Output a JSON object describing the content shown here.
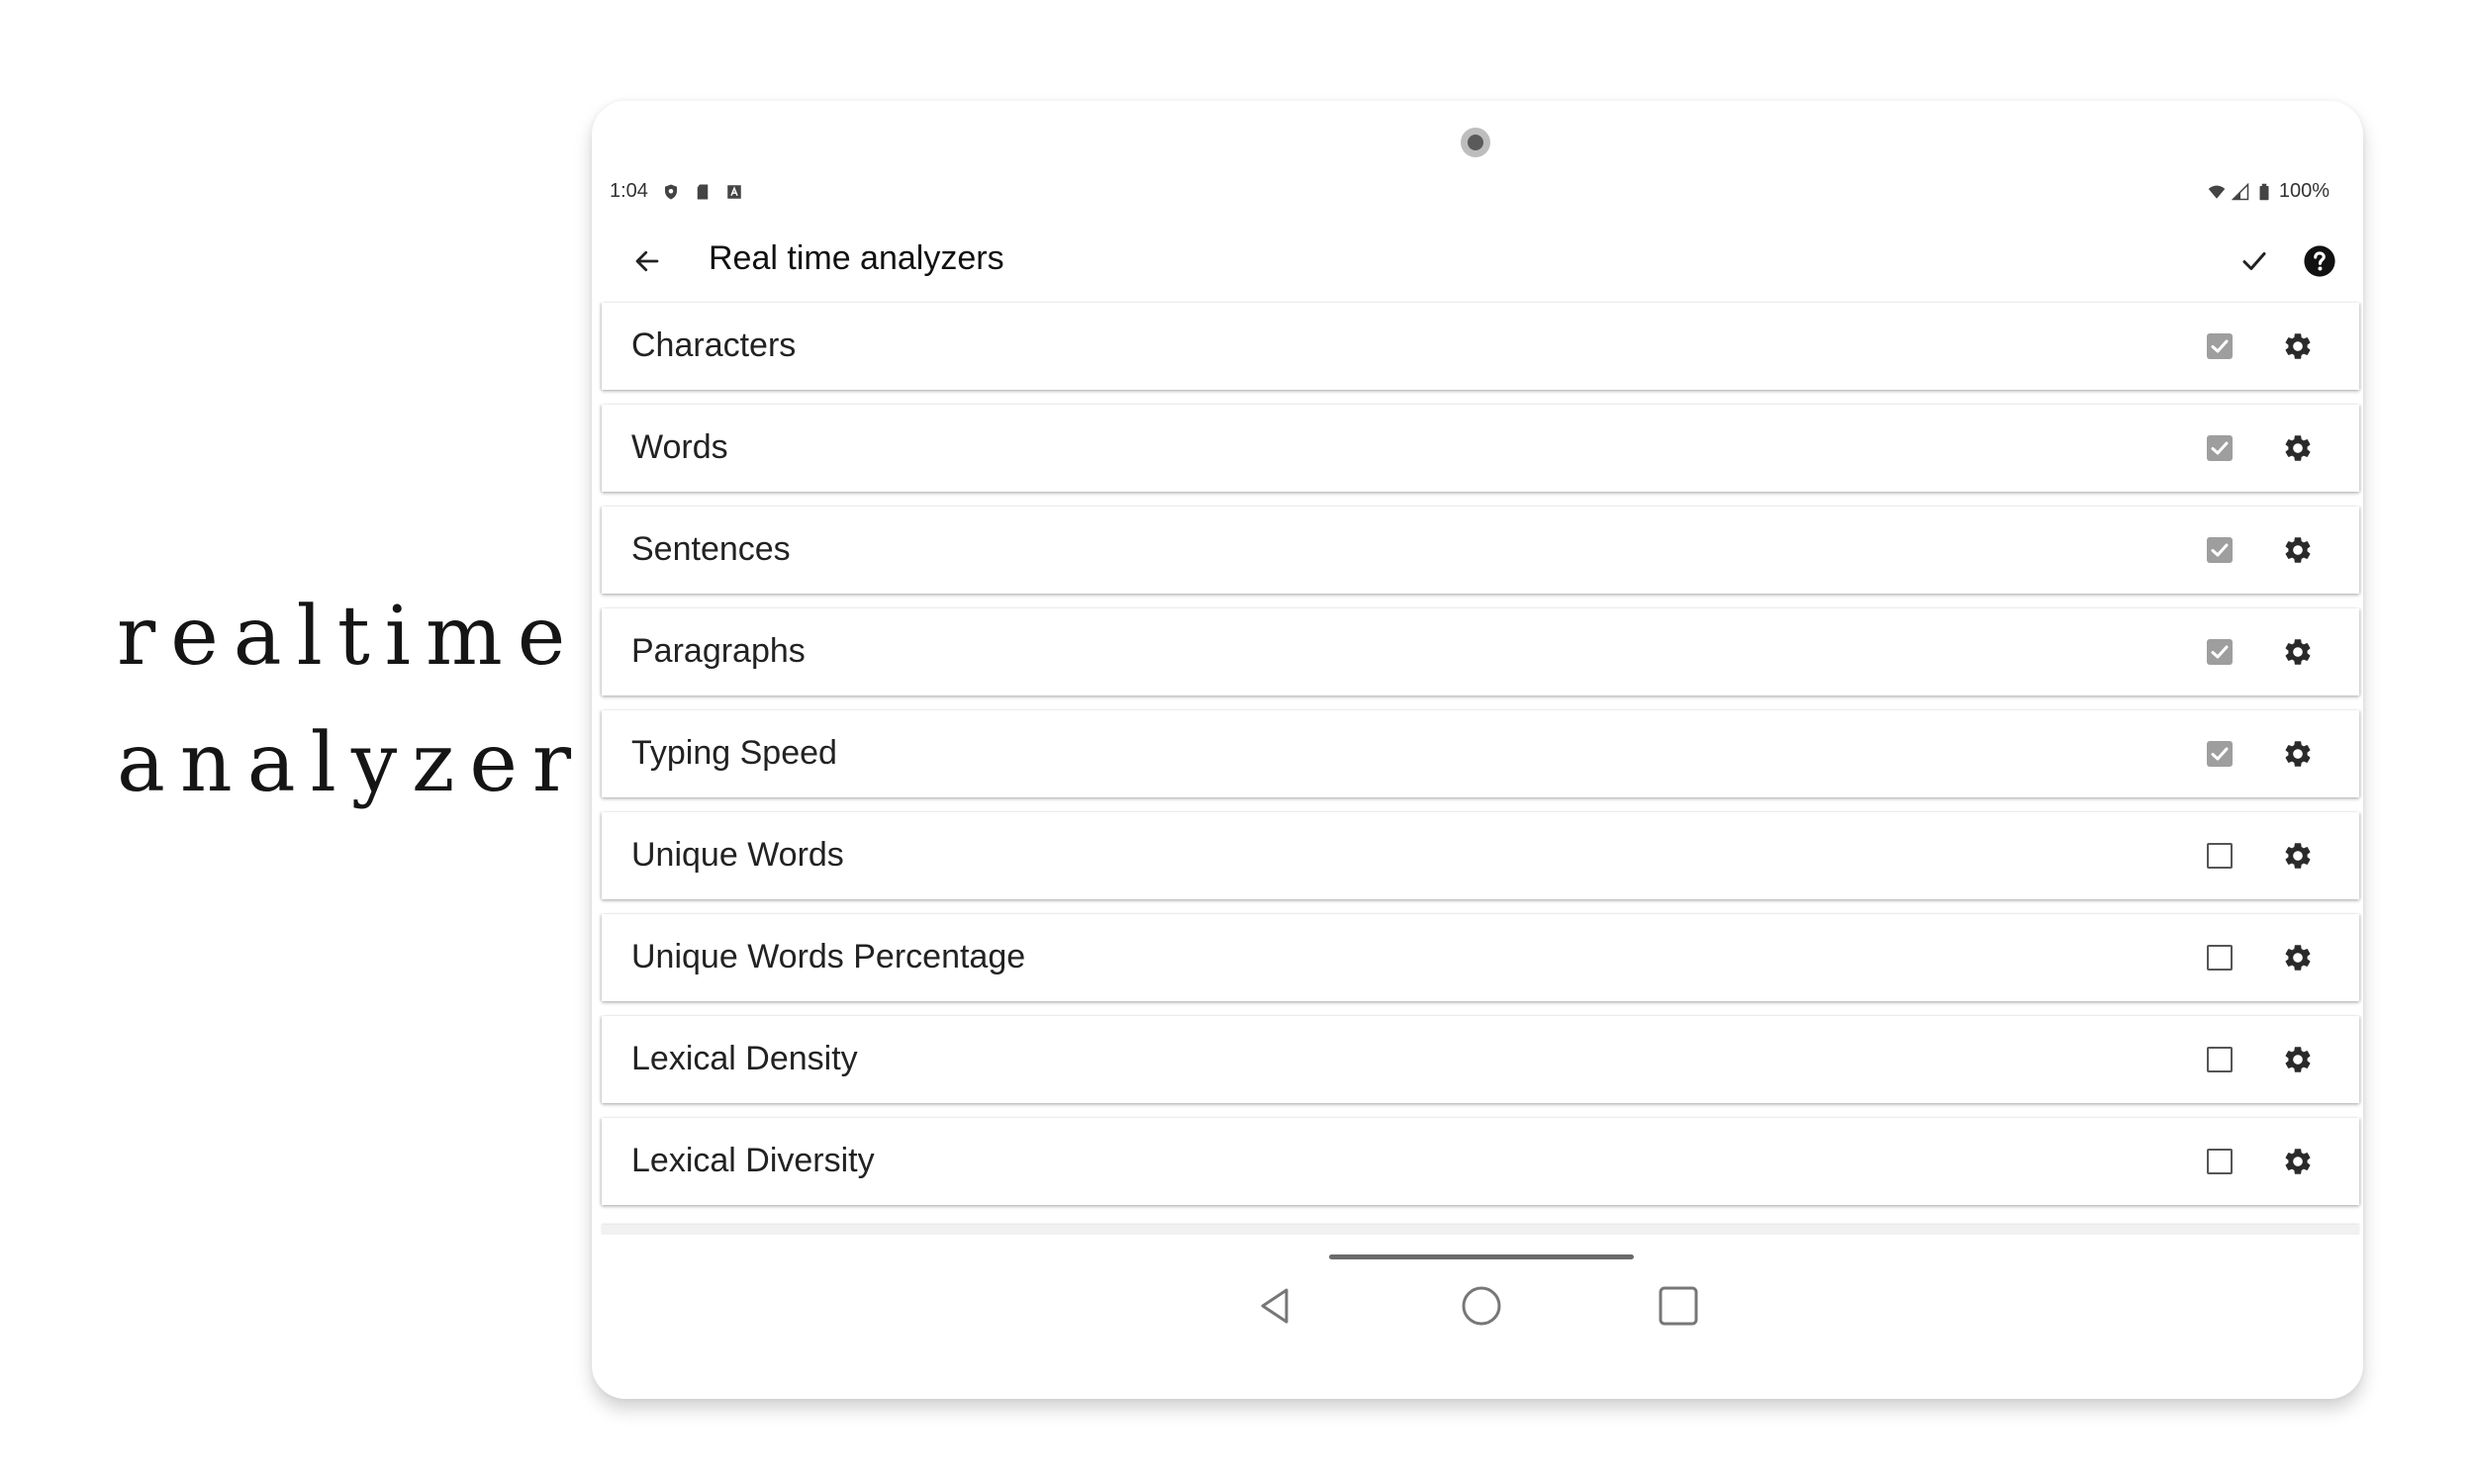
{
  "promo": {
    "line1": "realtime",
    "line2": "analyzer"
  },
  "statusbar": {
    "time": "1:04",
    "battery": "100%"
  },
  "appbar": {
    "title": "Real time analyzers"
  },
  "analyzers": [
    {
      "label": "Characters",
      "checked": true
    },
    {
      "label": "Words",
      "checked": true
    },
    {
      "label": "Sentences",
      "checked": true
    },
    {
      "label": "Paragraphs",
      "checked": true
    },
    {
      "label": "Typing Speed",
      "checked": true
    },
    {
      "label": "Unique Words",
      "checked": false
    },
    {
      "label": "Unique Words Percentage",
      "checked": false
    },
    {
      "label": "Lexical Density",
      "checked": false
    },
    {
      "label": "Lexical Diversity",
      "checked": false
    }
  ],
  "colors": {
    "checked_box": "#9e9e9e",
    "text": "#222222"
  }
}
